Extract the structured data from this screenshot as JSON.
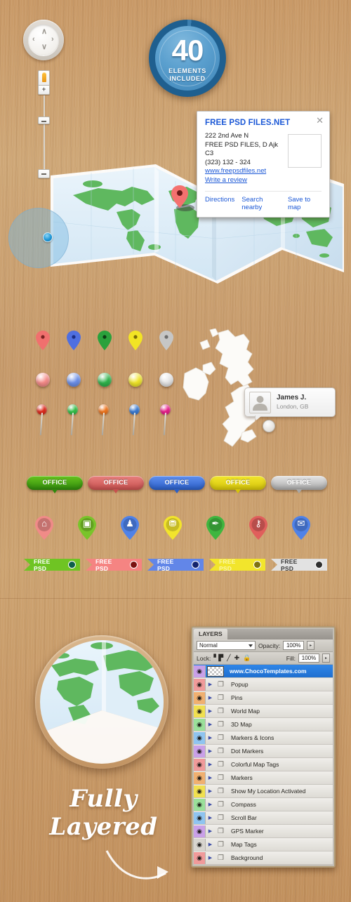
{
  "badge": {
    "number": "40",
    "line1": "ELEMENTS",
    "line2": "INCLUDED"
  },
  "compass": {
    "name": "compass-control",
    "up": "∧",
    "down": "∨",
    "left": "‹",
    "right": "›"
  },
  "zoom_control": {
    "pegman_label": "pegman",
    "plus": "+",
    "handle": "",
    "minus": ""
  },
  "info_window": {
    "title": "FREE PSD FILES.NET",
    "close": "✕",
    "address_line1": "222 2nd Ave N",
    "address_line2": "FREE PSD FILES, D Ajk C3",
    "phone": "(323) 132 - 324",
    "website": "www.freepsdfiles.net",
    "review_link": "Write a review",
    "actions": [
      "Directions",
      "Search nearby",
      "Save to map"
    ]
  },
  "user_card": {
    "name": "James J.",
    "location": "London, GB"
  },
  "teardrop_pins": [
    {
      "name": "pin-red",
      "color": "#f0706e",
      "dot": "#7a2322"
    },
    {
      "name": "pin-blue",
      "color": "#4f6fe0",
      "dot": "#1b2d84"
    },
    {
      "name": "pin-green",
      "color": "#2aa13c",
      "dot": "#0d3d14"
    },
    {
      "name": "pin-yellow",
      "color": "#f2e424",
      "dot": "#7a6b07"
    },
    {
      "name": "pin-gray",
      "color": "#c6c6c6",
      "dot": "#6e6e6e"
    }
  ],
  "dot_markers": [
    {
      "name": "dot-pink",
      "color": "#f58b89"
    },
    {
      "name": "dot-blue",
      "color": "#6c8fe8"
    },
    {
      "name": "dot-green",
      "color": "#2fb34b"
    },
    {
      "name": "dot-yellow",
      "color": "#f0e52a"
    },
    {
      "name": "dot-white",
      "color": "#e4e4e4"
    }
  ],
  "needle_pins": [
    {
      "name": "needle-red",
      "color": "#e02c1e"
    },
    {
      "name": "needle-green",
      "color": "#35c24a"
    },
    {
      "name": "needle-orange",
      "color": "#f07820"
    },
    {
      "name": "needle-blue",
      "color": "#3b7cd4"
    },
    {
      "name": "needle-pink",
      "color": "#ea1f8c"
    }
  ],
  "office_buttons": [
    {
      "label": "OFFICE",
      "color_top": "#67c41e",
      "color_bottom": "#2f8a0c",
      "name": "office-button-green"
    },
    {
      "label": "OFFICE",
      "color_top": "#e8807e",
      "color_bottom": "#c8504e",
      "name": "office-button-red"
    },
    {
      "label": "OFFICE",
      "color_top": "#5f8ff0",
      "color_bottom": "#2a5fc8",
      "name": "office-button-blue"
    },
    {
      "label": "OFFICE",
      "color_top": "#f2e62c",
      "color_bottom": "#d6c50a",
      "name": "office-button-yellow"
    },
    {
      "label": "OFFICE",
      "color_top": "#e6e6e6",
      "color_bottom": "#a8a8a8",
      "name": "office-button-gray"
    }
  ],
  "icon_markers": [
    {
      "name": "marker-home",
      "icon": "⌂",
      "color": "#f08b88",
      "glyph_color": "#fff"
    },
    {
      "name": "marker-camera",
      "icon": "▣",
      "color": "#79c42a",
      "glyph_color": "#fff"
    },
    {
      "name": "marker-user",
      "icon": "♟",
      "color": "#4f82e8",
      "glyph_color": "#fff"
    },
    {
      "name": "marker-cart",
      "icon": "⛃",
      "color": "#f2e42c",
      "glyph_color": "#fff"
    },
    {
      "name": "marker-brush",
      "icon": "✒",
      "color": "#3fb63f",
      "glyph_color": "#fff"
    },
    {
      "name": "marker-key",
      "icon": "⚷",
      "color": "#e05f5c",
      "glyph_color": "#fff"
    },
    {
      "name": "marker-mail",
      "icon": "✉",
      "color": "#4f82e8",
      "glyph_color": "#fff"
    }
  ],
  "psd_tags": [
    {
      "label": "FREE PSD",
      "color": "#6fc423",
      "text_color": "#ffffff",
      "knob": "#0d5f4a",
      "name": "psd-tag-green"
    },
    {
      "label": "FREE PSD",
      "color": "#f58482",
      "text_color": "#ffffff",
      "knob": "#7a1210",
      "name": "psd-tag-red"
    },
    {
      "label": "FREE PSD",
      "color": "#6286e8",
      "text_color": "#ffffff",
      "knob": "#13246e",
      "name": "psd-tag-blue"
    },
    {
      "label": "FREE PSD",
      "color": "#f2e52c",
      "text_color": "#fcf7a8",
      "knob": "#7d7212",
      "name": "psd-tag-yellow"
    },
    {
      "label": "FREE PSD",
      "color": "#e2e2e2",
      "text_color": "#3b3b3b",
      "knob": "#2f2f2f",
      "name": "psd-tag-gray"
    }
  ],
  "fully_layered": {
    "line1": "Fully",
    "line2": "Layered"
  },
  "layers_panel": {
    "tab": "LAYERS",
    "blend_mode": "Normal",
    "opacity_label": "Opacity:",
    "opacity_value": "100%",
    "lock_label": "Lock:",
    "fill_label": "Fill:",
    "fill_value": "100%",
    "lock_icons": [
      "⊠",
      "╱",
      "✚",
      "ὑ2"
    ],
    "stepper": "▸",
    "eye": "◉",
    "arrow": "▶",
    "folder": "❐",
    "layers": [
      {
        "name": "www.ChocoTemplates.com",
        "swatch": "#c9a0e8",
        "selected": true,
        "thumb": true
      },
      {
        "name": "Popup",
        "swatch": "#f09a9a",
        "selected": false,
        "thumb": false
      },
      {
        "name": "Pins",
        "swatch": "#f0b070",
        "selected": false,
        "thumb": false
      },
      {
        "name": "World Map",
        "swatch": "#f0e050",
        "selected": false,
        "thumb": false
      },
      {
        "name": "3D Map",
        "swatch": "#9ae09a",
        "selected": false,
        "thumb": false
      },
      {
        "name": "Markers & Icons",
        "swatch": "#8fc4f0",
        "selected": false,
        "thumb": false
      },
      {
        "name": "Dot Markers",
        "swatch": "#c9a0e8",
        "selected": false,
        "thumb": false
      },
      {
        "name": "Colorful Map Tags",
        "swatch": "#f09a9a",
        "selected": false,
        "thumb": false
      },
      {
        "name": "Markers",
        "swatch": "#f0b070",
        "selected": false,
        "thumb": false
      },
      {
        "name": "Show My Location Activated",
        "swatch": "#f0e050",
        "selected": false,
        "thumb": false
      },
      {
        "name": "Compass",
        "swatch": "#9ae09a",
        "selected": false,
        "thumb": false
      },
      {
        "name": "Scroll Bar",
        "swatch": "#8fc4f0",
        "selected": false,
        "thumb": false
      },
      {
        "name": "GPS Marker",
        "swatch": "#c9a0e8",
        "selected": false,
        "thumb": false
      },
      {
        "name": "Map Tags",
        "swatch": "#d8d5cf",
        "selected": false,
        "thumb": false
      },
      {
        "name": "Background",
        "swatch": "#f09a9a",
        "selected": false,
        "thumb": false
      }
    ]
  },
  "colors": {
    "wood": "#c79a6b",
    "badge_blue": "#3e85b8",
    "link_blue": "#1a57d6",
    "map_land": "#5cb85c",
    "map_water": "#dceaf5",
    "selected_row": "#2f86e8"
  }
}
